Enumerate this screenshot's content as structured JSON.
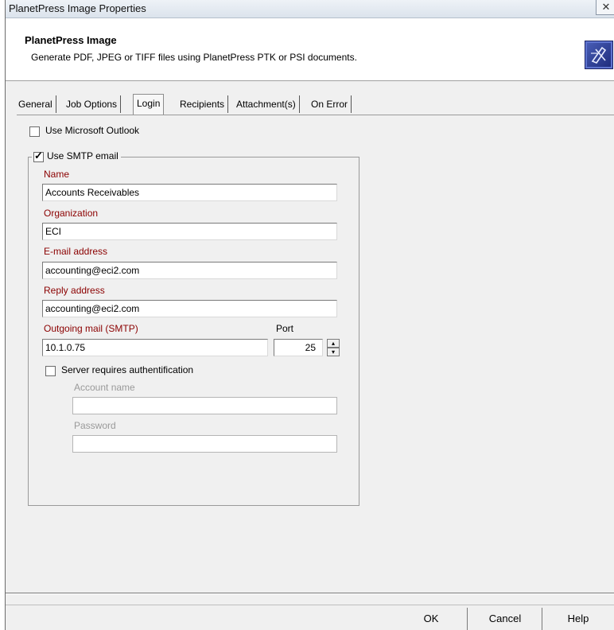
{
  "window": {
    "title": "PlanetPress Image Properties",
    "close_glyph": "✕"
  },
  "header": {
    "title": "PlanetPress Image",
    "subtitle": "Generate PDF, JPEG or TIFF files using PlanetPress PTK or PSI documents.",
    "icon": "planetpress-icon"
  },
  "tabs": [
    {
      "label": "General"
    },
    {
      "label": "Job Options"
    },
    {
      "label": "Login"
    },
    {
      "label": "Recipients"
    },
    {
      "label": "Attachment(s)"
    },
    {
      "label": "On Error"
    }
  ],
  "active_tab": "Login",
  "login": {
    "use_outlook": {
      "label": "Use Microsoft Outlook",
      "checked": false
    },
    "use_smtp": {
      "label": "Use SMTP email",
      "checked": true
    },
    "name": {
      "label": "Name",
      "value": "Accounts Receivables"
    },
    "organization": {
      "label": "Organization",
      "value": "ECI"
    },
    "email": {
      "label": "E-mail address",
      "value": "accounting@eci2.com"
    },
    "reply": {
      "label": "Reply address",
      "value": "accounting@eci2.com"
    },
    "smtp": {
      "label": "Outgoing mail (SMTP)",
      "value": "10.1.0.75"
    },
    "port": {
      "label": "Port",
      "value": "25"
    },
    "auth": {
      "label": "Server requires authentification",
      "checked": false
    },
    "account": {
      "label": "Account name",
      "value": ""
    },
    "password": {
      "label": "Password",
      "value": ""
    }
  },
  "buttons": {
    "ok": "OK",
    "cancel": "Cancel",
    "help": "Help"
  }
}
